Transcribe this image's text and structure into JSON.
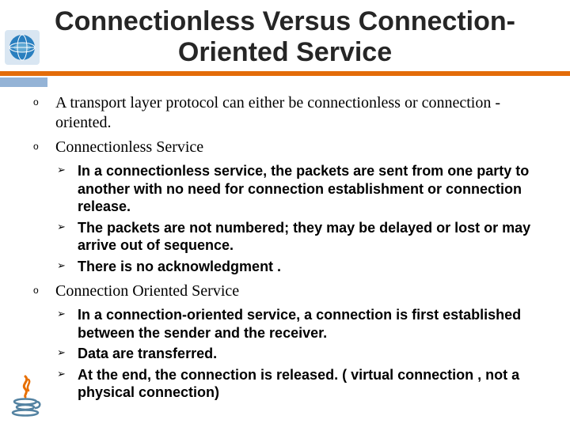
{
  "title": "Connectionless Versus Connection-Oriented Service",
  "points": {
    "p0": "A transport layer protocol can either be connectionless or connection -oriented.",
    "p1": "Connectionless Service",
    "p2": "Connection Oriented Service"
  },
  "connectionless": {
    "s0": " In a connectionless service, the packets are sent from one party to another with no need for connection establishment or connection release.",
    "s1": "The packets are not numbered; they may be delayed or lost or may arrive out of sequence.",
    "s2": "There is no acknowledgment ."
  },
  "oriented": {
    "s0": "In a connection-oriented service, a connection is first established between the sender and the receiver.",
    "s1": "Data are transferred.",
    "s2": "At the end, the connection is released. ( virtual connection , not a physical connection)"
  },
  "icons": {
    "globe": "globe-icon",
    "java": "java-logo-icon"
  }
}
